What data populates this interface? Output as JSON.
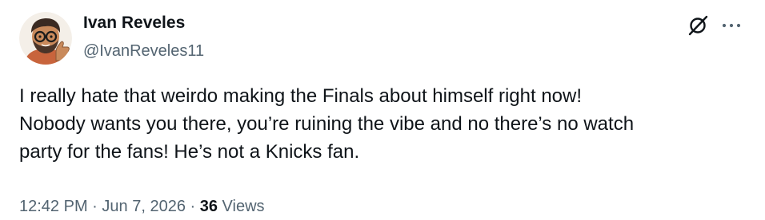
{
  "author": {
    "display_name": "Ivan Reveles",
    "handle": "@IvanReveles11"
  },
  "tweet": {
    "text_lines": [
      "I really hate that weirdo making the Finals about himself right now!",
      "Nobody wants you there, you’re ruining the vibe and no there’s no watch",
      "party for the fans! He’s not a Knicks fan."
    ]
  },
  "meta": {
    "time": "12:42 PM",
    "separator": "·",
    "date": "Jun 7, 2026",
    "views_count": "36",
    "views_label": "Views"
  },
  "icons": {
    "header_right": [
      "grok-icon",
      "more-options-icon"
    ],
    "avatar": "cartoon-avatar"
  },
  "colors": {
    "text_primary": "#0f1419",
    "text_secondary": "#536471",
    "background": "#ffffff"
  }
}
